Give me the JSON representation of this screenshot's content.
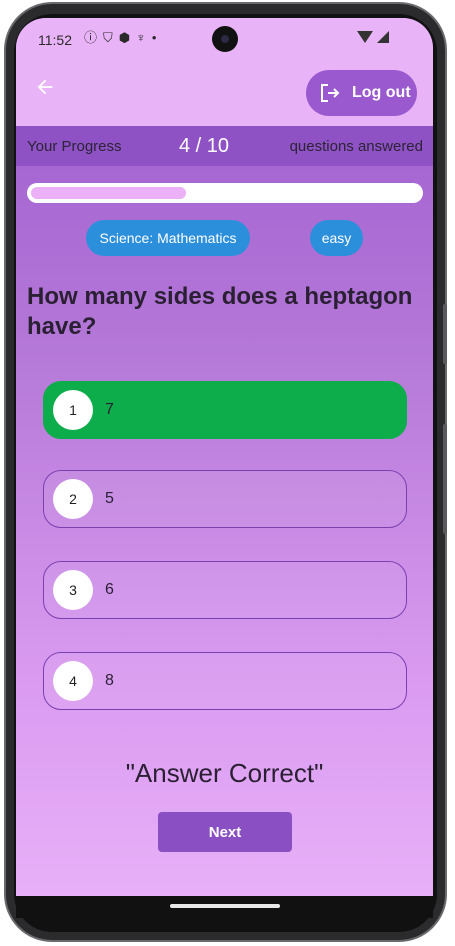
{
  "status_bar": {
    "time": "11:52",
    "icons": [
      "info-icon",
      "shield-icon",
      "shield-check-icon",
      "mic-icon",
      "dot-icon"
    ],
    "right_icons": [
      "wifi-icon",
      "signal-icon"
    ]
  },
  "app_bar": {
    "back_icon": "arrow-left-icon",
    "logout_label": "Log out",
    "logout_icon": "logout-icon"
  },
  "progress": {
    "label_left": "Your Progress",
    "count": "4 / 10",
    "label_right": "questions answered",
    "fraction": 0.4
  },
  "chips": {
    "category": "Science: Mathematics",
    "difficulty": "easy"
  },
  "question": "How many sides does a heptagon have?",
  "options": [
    {
      "number": "1",
      "text": "7",
      "state": "correct"
    },
    {
      "number": "2",
      "text": "5",
      "state": "default"
    },
    {
      "number": "3",
      "text": "6",
      "state": "default"
    },
    {
      "number": "4",
      "text": "8",
      "state": "default"
    }
  ],
  "result_text": "\"Answer Correct\"",
  "next_label": "Next",
  "colors": {
    "app_bar": "#e9b3f7",
    "accent": "#9b59cf",
    "chip": "#2c8fdc",
    "correct": "#0ead4c"
  }
}
